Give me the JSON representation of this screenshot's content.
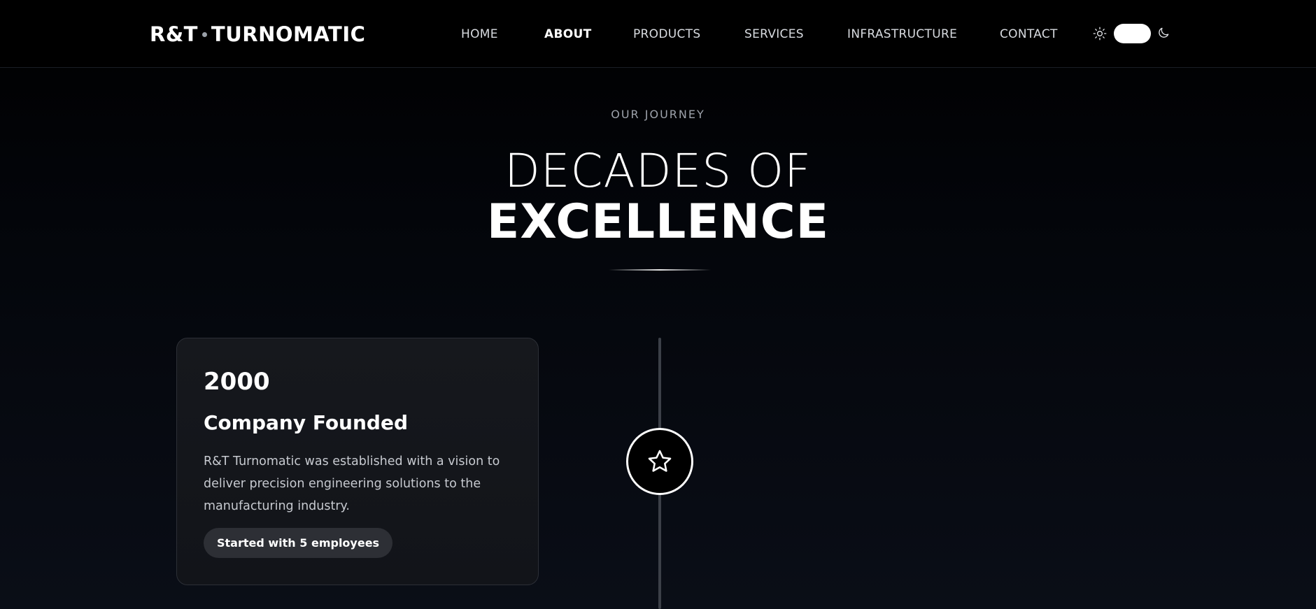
{
  "header": {
    "logo_left": "R&T",
    "logo_right": "TURNOMATIC",
    "nav": [
      {
        "label": "HOME",
        "active": false
      },
      {
        "label": "ABOUT",
        "active": true
      },
      {
        "label": "PRODUCTS",
        "active": false
      },
      {
        "label": "SERVICES",
        "active": false
      },
      {
        "label": "INFRASTRUCTURE",
        "active": false
      },
      {
        "label": "CONTACT",
        "active": false
      }
    ],
    "theme_toggle": {
      "light_icon": "sun-icon",
      "dark_icon": "moon-icon"
    }
  },
  "section": {
    "eyebrow": "OUR JOURNEY",
    "title_light": "DECADES OF",
    "title_bold": "EXCELLENCE"
  },
  "timeline": {
    "items": [
      {
        "year": "2000",
        "title": "Company Founded",
        "description": "R&T Turnomatic was established with a vision to deliver precision engineering solutions to the manufacturing industry.",
        "badge": "Started with 5 employees",
        "icon": "star-icon"
      }
    ]
  },
  "colors": {
    "background": "#000000",
    "card": "#16181d",
    "badge": "#2d2f35",
    "timeline_line": "#3c4048",
    "text_primary": "#ffffff",
    "text_muted": "#9ea3ab"
  }
}
